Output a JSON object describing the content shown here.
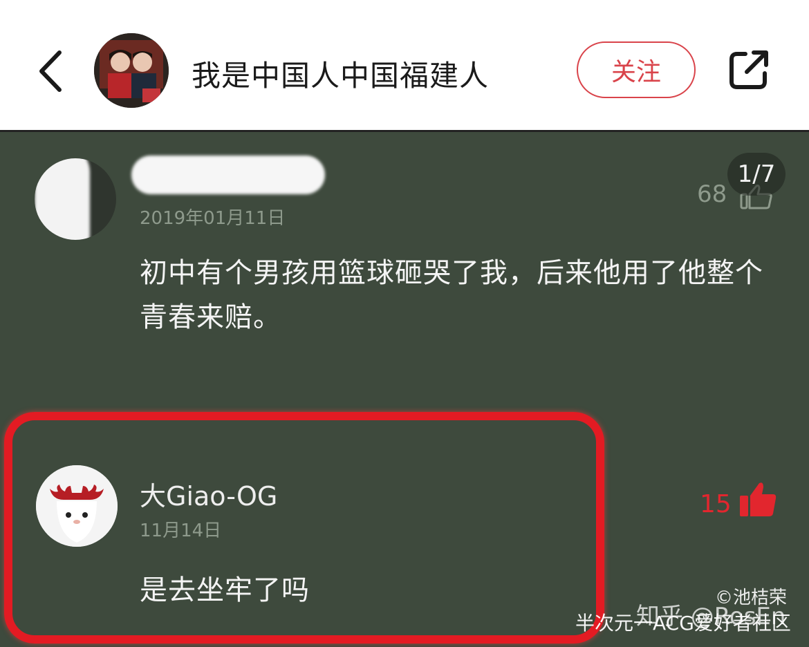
{
  "header": {
    "title": "我是中国人中国福建人",
    "follow_label": "关注"
  },
  "comment1": {
    "date": "2019年01月11日",
    "likes": "68",
    "text": "初中有个男孩用篮球砸哭了我，后来他用了他整个青春来赔。"
  },
  "page_indicator": "1/7",
  "comment2": {
    "username": "大Giao-OG",
    "date": "11月14日",
    "text": "是去坐牢了吗",
    "likes": "15"
  },
  "watermarks": {
    "line1": "©池桔荣",
    "line2": "知乎 @RosEn",
    "line3": "半次元一ACG爱好者社区"
  },
  "icons": {
    "back": "chevron-left-icon",
    "share": "share-external-icon",
    "like": "thumbs-up-icon"
  },
  "colors": {
    "accent": "#d9434a",
    "background": "#3e4a3d",
    "highlight": "#e31b23"
  }
}
